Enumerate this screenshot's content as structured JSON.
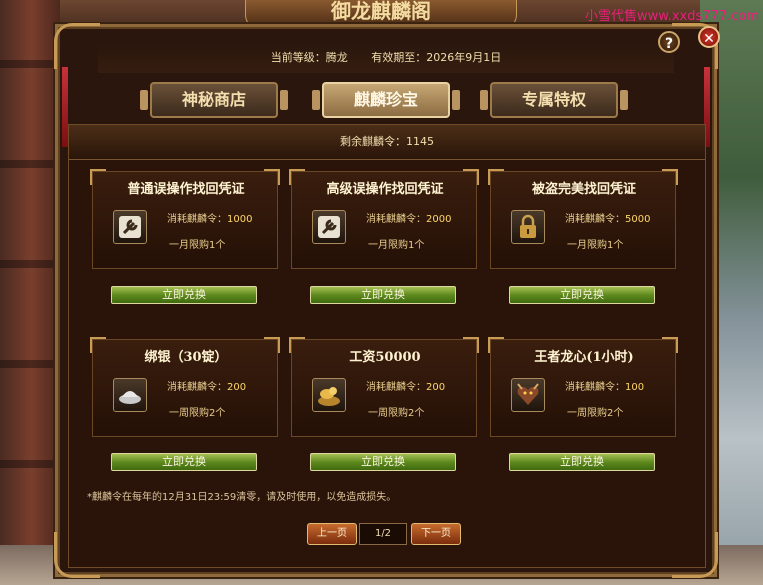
{
  "watermark": "小雪代售www.xxds777.com",
  "header": {
    "plate_title": "御龙麒麟阁",
    "level_text": "当前等级：腾龙",
    "expiry_text": "有效期至：2026年9月1日"
  },
  "tabs": [
    {
      "label": "神秘商店",
      "active": false
    },
    {
      "label": "麒麟珍宝",
      "active": true
    },
    {
      "label": "专属特权",
      "active": false
    }
  ],
  "remaining_text": "剩余麒麟令：1145",
  "cost_prefix": "消耗麒麟令：",
  "items": [
    {
      "title": "普通误操作找回凭证",
      "icon": "wrench-icon",
      "cost": "1000",
      "limit": "一月限购1个",
      "button": "立即兑换"
    },
    {
      "title": "高级误操作找回凭证",
      "icon": "wrench-icon",
      "cost": "2000",
      "limit": "一月限购1个",
      "button": "立即兑换"
    },
    {
      "title": "被盗完美找回凭证",
      "icon": "lock-icon",
      "cost": "5000",
      "limit": "一月限购1个",
      "button": "立即兑换"
    },
    {
      "title": "绑银（30锭）",
      "icon": "silver-ingot-icon",
      "cost": "200",
      "limit": "一周限购2个",
      "button": "立即兑换"
    },
    {
      "title": "工资50000",
      "icon": "gold-coins-icon",
      "cost": "200",
      "limit": "一周限购2个",
      "button": "立即兑换"
    },
    {
      "title": "王者龙心(1小时)",
      "icon": "dragon-heart-icon",
      "cost": "100",
      "limit": "一周限购2个",
      "button": "立即兑换"
    }
  ],
  "notice": "*麒麟令在每年的12月31日23:59清零，请及时使用，以免造成损失。",
  "pager": {
    "prev": "上一页",
    "page": "1/2",
    "next": "下一页"
  },
  "colors": {
    "frame_gold": "#c79a55",
    "cost_number": "#ffd766",
    "buy_button_green": "#5f8a1e",
    "pager_orange": "#c76b2e"
  }
}
